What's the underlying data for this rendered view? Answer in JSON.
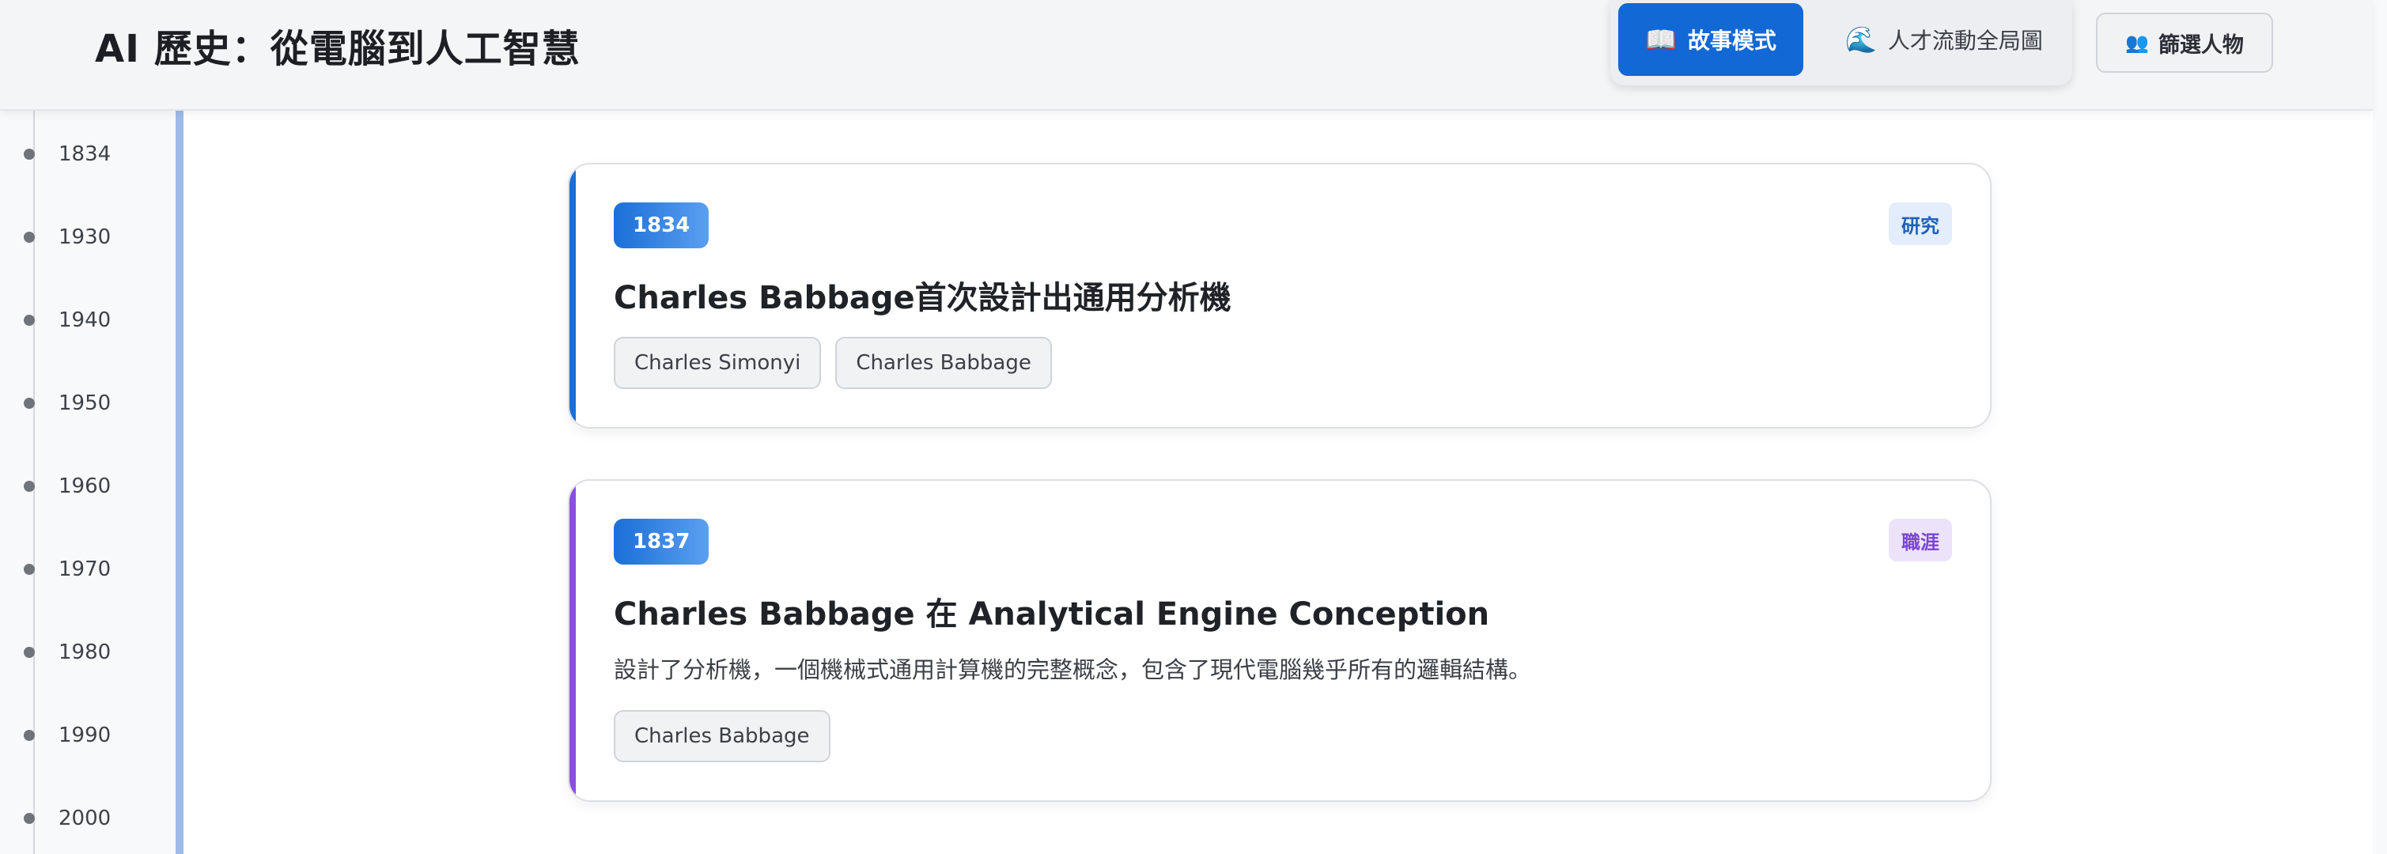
{
  "app": {
    "title": "AI 歷史：從電腦到人工智慧"
  },
  "header": {
    "modes": [
      {
        "label": "故事模式",
        "icon": "open-book-icon",
        "active": true
      },
      {
        "label": "人才流動全局圖",
        "icon": "wave-icon",
        "active": false
      }
    ],
    "filter_label": "篩選人物",
    "filter_icon": "people-icon"
  },
  "sidebar": {
    "years": [
      "1834",
      "1930",
      "1940",
      "1950",
      "1960",
      "1970",
      "1980",
      "1990",
      "2000"
    ]
  },
  "events": [
    {
      "year": "1834",
      "category": "研究",
      "title": "Charles Babbage首次設計出通用分析機",
      "description": "",
      "people": [
        "Charles Simonyi",
        "Charles Babbage"
      ]
    },
    {
      "year": "1837",
      "category": "職涯",
      "title": "Charles Babbage 在 Analytical Engine Conception",
      "description": "設計了分析機，一個機械式通用計算機的完整概念，包含了現代電腦幾乎所有的邏輯結構。",
      "people": [
        "Charles Babbage"
      ]
    }
  ],
  "colors": {
    "primary": "#1268d4",
    "research_accent": "#1a6fd8",
    "research_badge_bg": "#e3edfb",
    "research_badge_text": "#1f5fb8",
    "career_accent": "#8a4fe0",
    "career_badge_bg": "#ece3fb",
    "career_badge_text": "#7b45d3",
    "sidebar_bar": "#9fbbe9"
  }
}
